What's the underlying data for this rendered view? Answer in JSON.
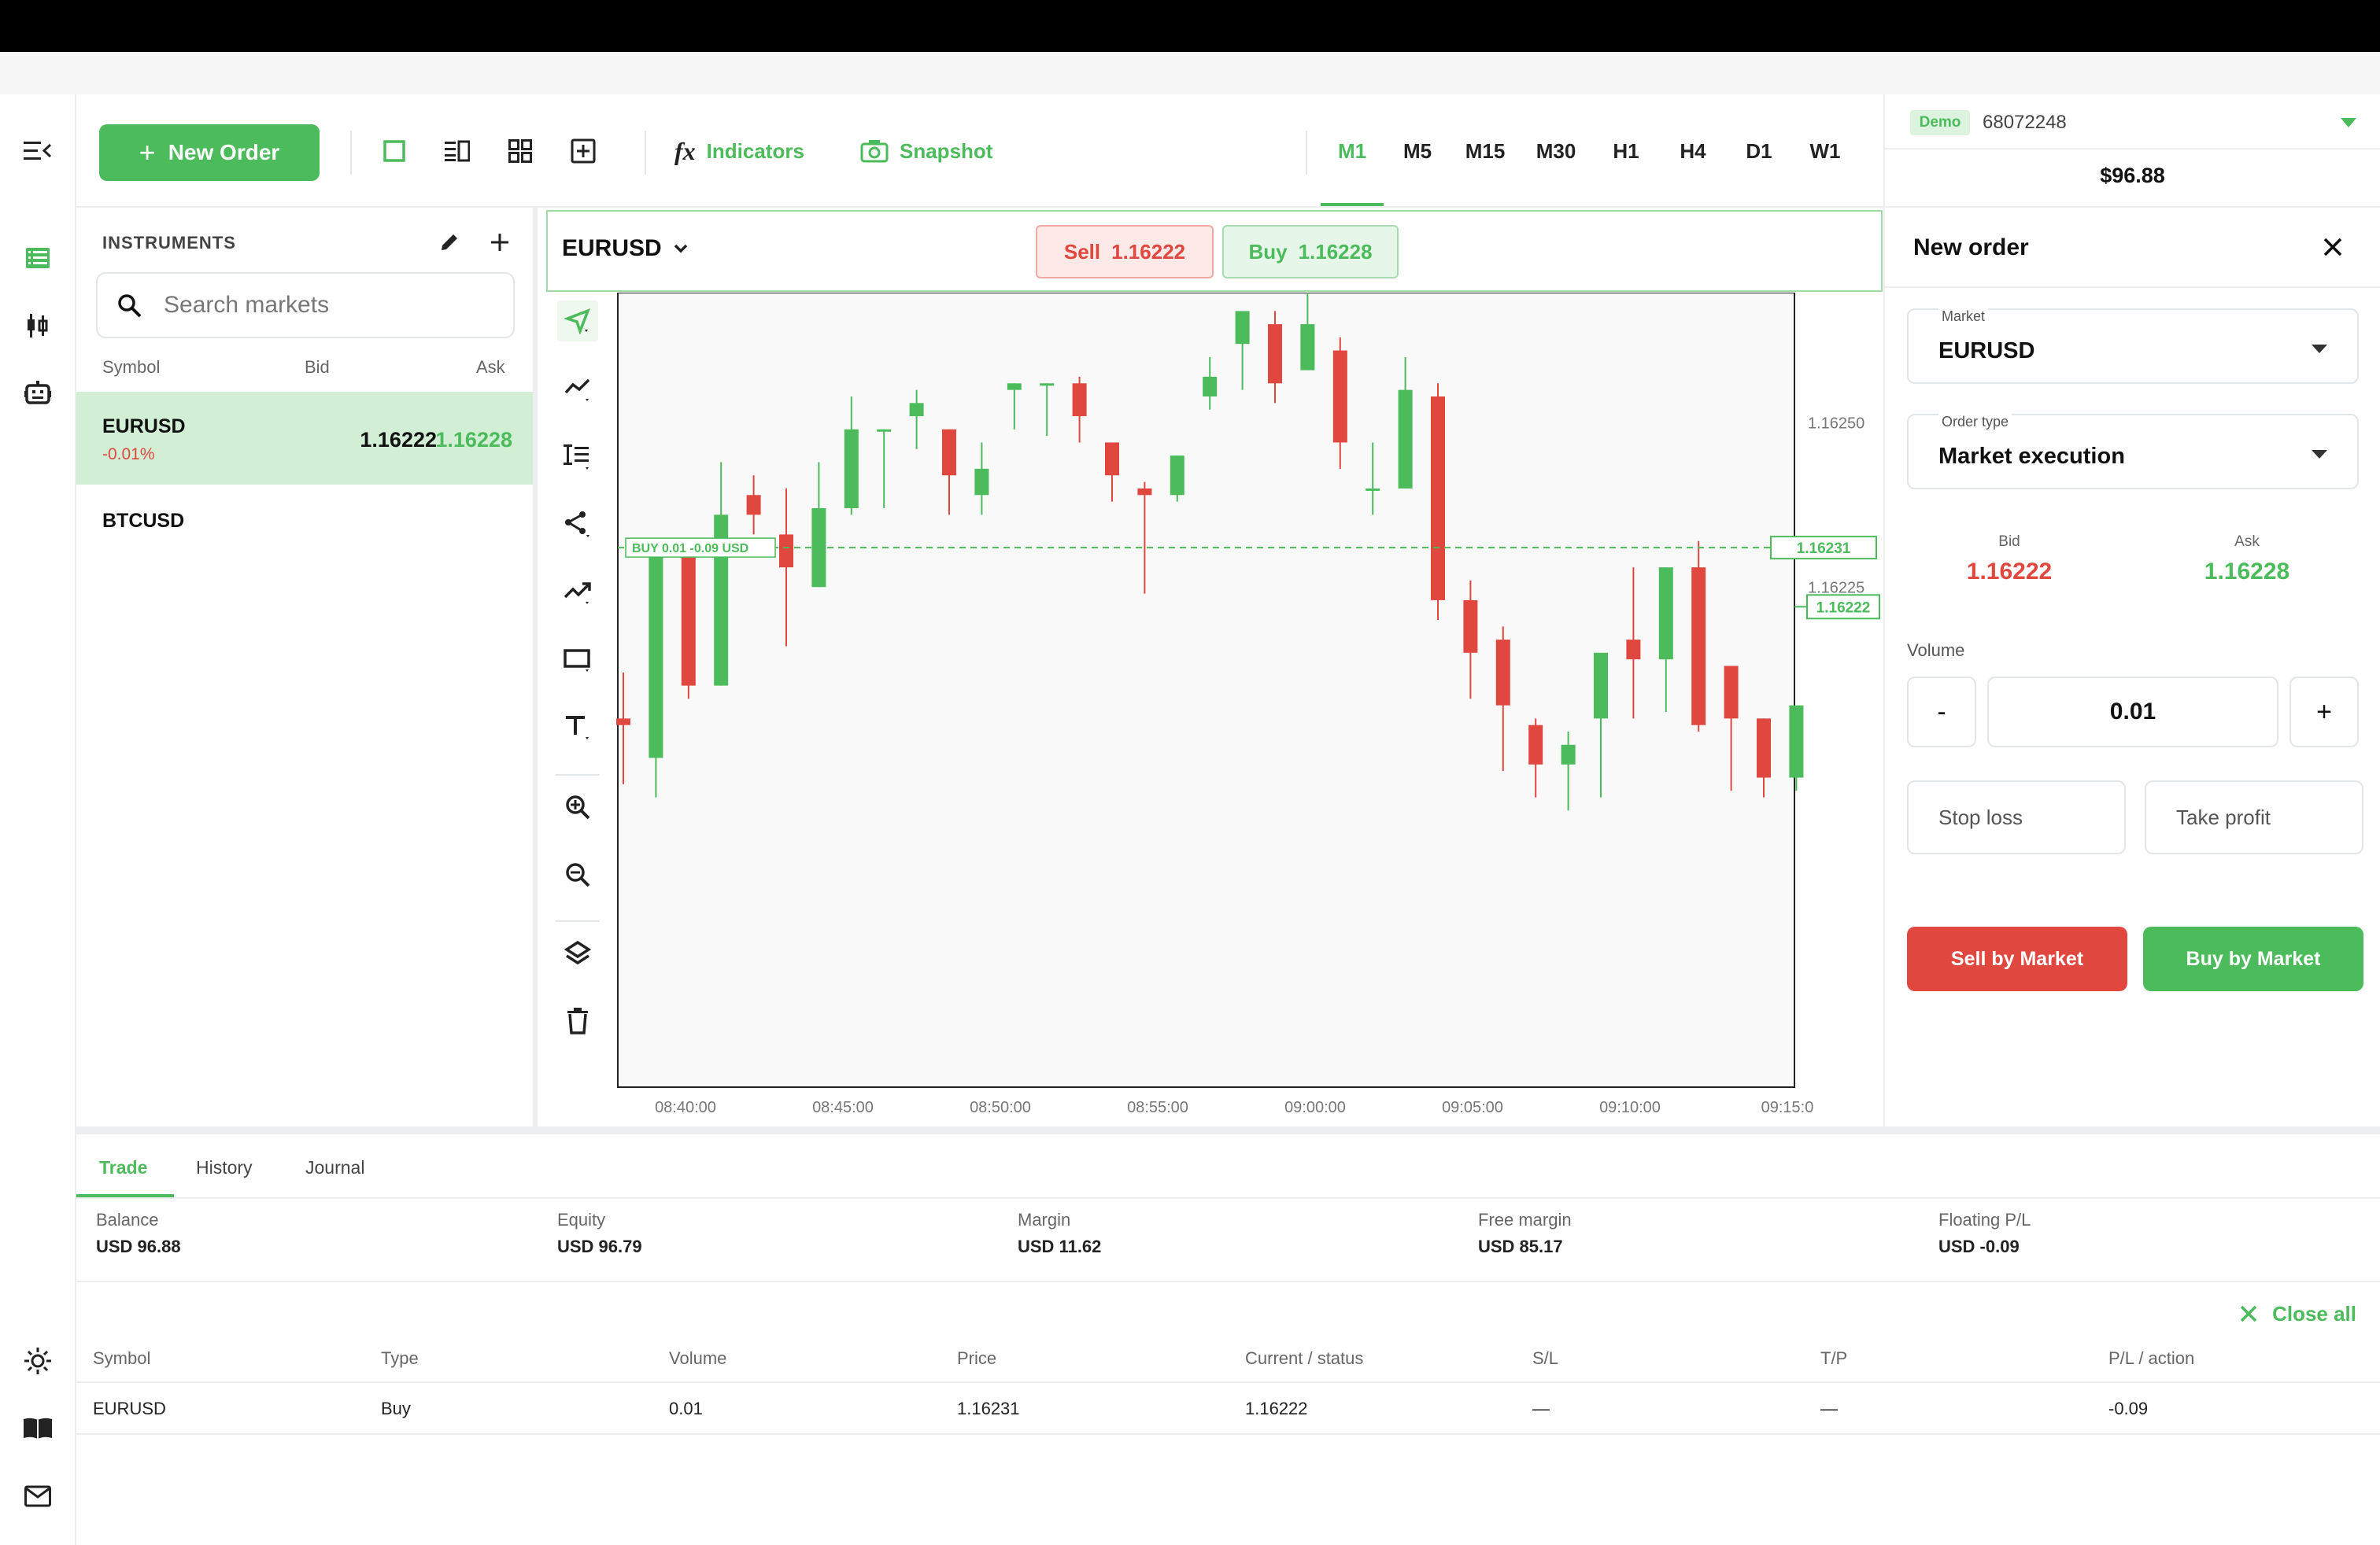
{
  "toolbar": {
    "new_order_label": "New Order",
    "indicators_label": "Indicators",
    "snapshot_label": "Snapshot",
    "timeframes": [
      "M1",
      "M5",
      "M15",
      "M30",
      "H1",
      "H4",
      "D1",
      "W1"
    ],
    "active_timeframe": "M1"
  },
  "account": {
    "badge": "Demo",
    "id": "68072248",
    "balance": "$96.88"
  },
  "instruments": {
    "title": "INSTRUMENTS",
    "search_placeholder": "Search markets",
    "columns": {
      "symbol": "Symbol",
      "bid": "Bid",
      "ask": "Ask"
    },
    "rows": [
      {
        "symbol": "EURUSD",
        "change": "-0.01%",
        "bid": "1.16222",
        "ask": "1.16228",
        "selected": true
      },
      {
        "symbol": "BTCUSD",
        "change": "",
        "bid": "",
        "ask": "",
        "selected": false
      }
    ]
  },
  "chart_header": {
    "symbol": "EURUSD",
    "sell_label": "Sell",
    "sell_price": "1.16222",
    "buy_label": "Buy",
    "buy_price": "1.16228"
  },
  "chart_data": {
    "type": "candlestick",
    "x_ticks": [
      "08:40:00",
      "08:45:00",
      "08:50:00",
      "08:55:00",
      "09:00:00",
      "09:05:00",
      "09:10:00",
      "09:15:0"
    ],
    "y_ticks": [
      {
        "value": 1.1625,
        "label": "1.16250"
      },
      {
        "value": 1.16225,
        "label": "1.16225"
      }
    ],
    "ylim": [
      1.161489,
      1.162698
    ],
    "position_line": {
      "price": 1.16231,
      "label": "1.16231",
      "text": "BUY 0.01 -0.09 USD"
    },
    "current_price": {
      "price": 1.16222,
      "label": "1.16222"
    },
    "colors": {
      "up": "#4cbb5b",
      "down": "#e0473f"
    },
    "candles": [
      {
        "o": 1.16205,
        "h": 1.16212,
        "l": 1.16195,
        "c": 1.16204
      },
      {
        "o": 1.16199,
        "h": 1.16231,
        "l": 1.16193,
        "c": 1.1623
      },
      {
        "o": 1.1623,
        "h": 1.16232,
        "l": 1.16208,
        "c": 1.1621
      },
      {
        "o": 1.1621,
        "h": 1.16244,
        "l": 1.1621,
        "c": 1.16236
      },
      {
        "o": 1.16239,
        "h": 1.16242,
        "l": 1.16233,
        "c": 1.16236
      },
      {
        "o": 1.16233,
        "h": 1.1624,
        "l": 1.16216,
        "c": 1.16228
      },
      {
        "o": 1.16225,
        "h": 1.16244,
        "l": 1.16225,
        "c": 1.16237
      },
      {
        "o": 1.16237,
        "h": 1.16254,
        "l": 1.16236,
        "c": 1.16249
      },
      {
        "o": 1.16249,
        "h": 1.16249,
        "l": 1.16237,
        "c": 1.16249
      },
      {
        "o": 1.16251,
        "h": 1.16255,
        "l": 1.16246,
        "c": 1.16253
      },
      {
        "o": 1.16249,
        "h": 1.16249,
        "l": 1.16236,
        "c": 1.16242
      },
      {
        "o": 1.16239,
        "h": 1.16247,
        "l": 1.16236,
        "c": 1.16243
      },
      {
        "o": 1.16255,
        "h": 1.16256,
        "l": 1.16249,
        "c": 1.16256
      },
      {
        "o": 1.16256,
        "h": 1.16256,
        "l": 1.16248,
        "c": 1.16256
      },
      {
        "o": 1.16256,
        "h": 1.16257,
        "l": 1.16247,
        "c": 1.16251
      },
      {
        "o": 1.16247,
        "h": 1.16247,
        "l": 1.16238,
        "c": 1.16242
      },
      {
        "o": 1.1624,
        "h": 1.16241,
        "l": 1.16224,
        "c": 1.16239
      },
      {
        "o": 1.16239,
        "h": 1.16245,
        "l": 1.16238,
        "c": 1.16245
      },
      {
        "o": 1.16254,
        "h": 1.1626,
        "l": 1.16252,
        "c": 1.16257
      },
      {
        "o": 1.16262,
        "h": 1.16266,
        "l": 1.16255,
        "c": 1.16267
      },
      {
        "o": 1.16265,
        "h": 1.16267,
        "l": 1.16253,
        "c": 1.16256
      },
      {
        "o": 1.16258,
        "h": 1.1627,
        "l": 1.16258,
        "c": 1.16265
      },
      {
        "o": 1.16261,
        "h": 1.16263,
        "l": 1.16243,
        "c": 1.16247
      },
      {
        "o": 1.1624,
        "h": 1.16247,
        "l": 1.16236,
        "c": 1.1624
      },
      {
        "o": 1.1624,
        "h": 1.1626,
        "l": 1.1624,
        "c": 1.16255
      },
      {
        "o": 1.16254,
        "h": 1.16256,
        "l": 1.1622,
        "c": 1.16223
      },
      {
        "o": 1.16223,
        "h": 1.16226,
        "l": 1.16208,
        "c": 1.16215
      },
      {
        "o": 1.16217,
        "h": 1.16219,
        "l": 1.16197,
        "c": 1.16207
      },
      {
        "o": 1.16204,
        "h": 1.16205,
        "l": 1.16193,
        "c": 1.16198
      },
      {
        "o": 1.16198,
        "h": 1.16203,
        "l": 1.16191,
        "c": 1.16201
      },
      {
        "o": 1.16205,
        "h": 1.16214,
        "l": 1.16193,
        "c": 1.16215
      },
      {
        "o": 1.16217,
        "h": 1.16228,
        "l": 1.16205,
        "c": 1.16214
      },
      {
        "o": 1.16214,
        "h": 1.16228,
        "l": 1.16206,
        "c": 1.16228
      },
      {
        "o": 1.16228,
        "h": 1.16232,
        "l": 1.16203,
        "c": 1.16204
      },
      {
        "o": 1.16213,
        "h": 1.16213,
        "l": 1.16194,
        "c": 1.16205
      },
      {
        "o": 1.16205,
        "h": 1.16205,
        "l": 1.16193,
        "c": 1.16196
      },
      {
        "o": 1.16196,
        "h": 1.16204,
        "l": 1.16194,
        "c": 1.16207
      }
    ]
  },
  "order": {
    "title": "New order",
    "market_label": "Market",
    "market_value": "EURUSD",
    "order_type_label": "Order type",
    "order_type_value": "Market execution",
    "bid_label": "Bid",
    "bid_value": "1.16222",
    "ask_label": "Ask",
    "ask_value": "1.16228",
    "volume_label": "Volume",
    "volume_minus": "-",
    "volume_value": "0.01",
    "volume_plus": "+",
    "stop_loss": "Stop loss",
    "take_profit": "Take profit",
    "sell_button": "Sell by Market",
    "buy_button": "Buy by Market"
  },
  "bottom": {
    "tabs": [
      "Trade",
      "History",
      "Journal"
    ],
    "summary": [
      {
        "label": "Balance",
        "value": "USD 96.88"
      },
      {
        "label": "Equity",
        "value": "USD 96.79"
      },
      {
        "label": "Margin",
        "value": "USD 11.62"
      },
      {
        "label": "Free margin",
        "value": "USD 85.17"
      },
      {
        "label": "Floating P/L",
        "value": "USD -0.09"
      }
    ],
    "close_all": "Close all",
    "columns": [
      "Symbol",
      "Type",
      "Volume",
      "Price",
      "Current / status",
      "S/L",
      "T/P",
      "P/L / action"
    ],
    "rows": [
      [
        "EURUSD",
        "Buy",
        "0.01",
        "1.16231",
        "1.16222",
        "—",
        "—",
        "-0.09"
      ]
    ]
  },
  "colors": {
    "accent": "#4cbb5b",
    "sell": "#e0473f",
    "selected_row": "#d2efd6"
  }
}
